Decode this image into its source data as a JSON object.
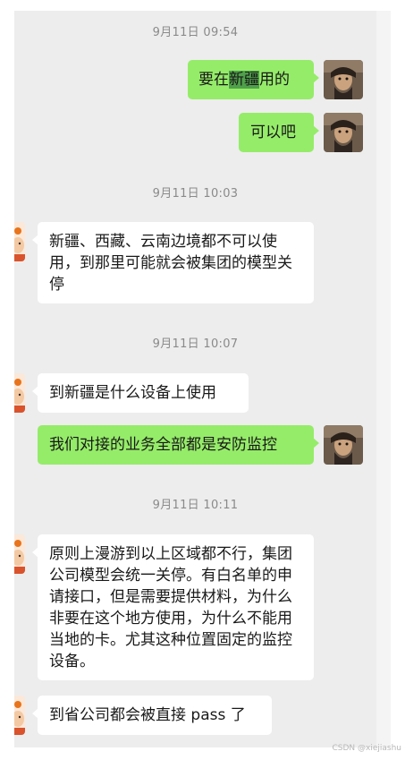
{
  "messages": [
    {
      "kind": "time",
      "text": "9月11日 09:54"
    },
    {
      "kind": "sent",
      "pre": "要在",
      "highlight": "新疆",
      "post": "用的"
    },
    {
      "kind": "sent",
      "text": "可以吧"
    },
    {
      "kind": "time",
      "text": "9月11日 10:03"
    },
    {
      "kind": "recv",
      "text": "新疆、西藏、云南边境都不可以使用，到那里可能就会被集团的模型关停"
    },
    {
      "kind": "time",
      "text": "9月11日 10:07"
    },
    {
      "kind": "recv",
      "text": "到新疆是什么设备上使用"
    },
    {
      "kind": "sent",
      "text": "我们对接的业务全部都是安防监控"
    },
    {
      "kind": "time",
      "text": "9月11日 10:11"
    },
    {
      "kind": "recv",
      "text": "原则上漫游到以上区域都不行，集团公司模型会统一关停。有白名单的申请接口，但是需要提供材料，为什么非要在这个地方使用，为什么不能用当地的卡。尤其这种位置固定的监控设备。"
    },
    {
      "kind": "recv",
      "text": "到省公司都会被直接 pass 了"
    }
  ],
  "watermark": "CSDN @xiejiashu",
  "colors": {
    "chat_background": "#ededed",
    "sent_bubble": "#95ec69",
    "received_bubble": "#ffffff",
    "timestamp_text": "#8a8a8a",
    "highlight": "#4fa04a"
  }
}
